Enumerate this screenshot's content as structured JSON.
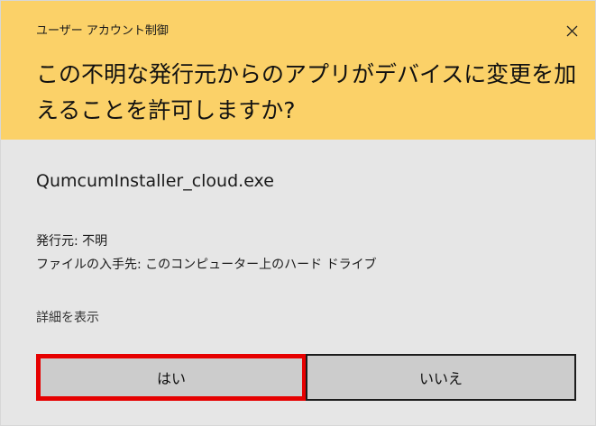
{
  "dialog": {
    "title": "ユーザー アカウント制御",
    "question": "この不明な発行元からのアプリがデバイスに変更を加えることを許可しますか?",
    "program_name": "QumcumInstaller_cloud.exe",
    "publisher_line": "発行元: 不明",
    "origin_line": "ファイルの入手先: このコンピューター上のハード ドライブ",
    "details_link": "詳細を表示",
    "yes_label": "はい",
    "no_label": "いいえ",
    "header_color": "#fbd168",
    "highlight_color": "#e60000"
  },
  "icons": {
    "close": "close-icon"
  }
}
